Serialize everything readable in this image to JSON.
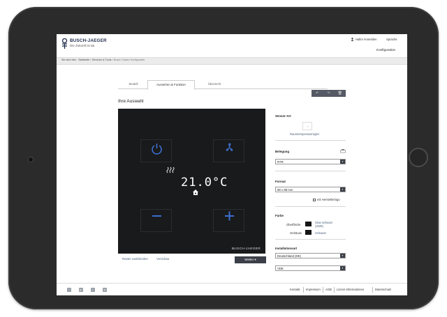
{
  "header": {
    "brand": "BUSCH-JAEGER",
    "tagline": "Die Zukunft ist da.",
    "login": "Hallo! Anmelden",
    "language": "Sprache",
    "page": "Konfiguration"
  },
  "breadcrumb": {
    "prefix": "Sie sind hier:",
    "items": [
      "Startseite",
      "Services & Tools",
      "Busch-Tastex Konfigurator"
    ]
  },
  "tabs": [
    "Modell",
    "Aussehen & Funktion",
    "Übersicht"
  ],
  "toolbar": {
    "undo_icon": "↶",
    "redo_icon": "↷",
    "delete_icon": "🗑"
  },
  "main": {
    "heading": "Ihre Auswahl",
    "display_temp": "21.0°C",
    "preview_brand": "BUSCH-JAEGER",
    "links": [
      "Raster ausblenden",
      "Vorschau"
    ],
    "next_button": "Weiter"
  },
  "right_panel": {
    "sensor_label": "Sensor-Art",
    "sensor_value": "Raumtemperaturregler",
    "belegung_label": "Belegung",
    "belegung_value": "RTR",
    "format_label": "Format",
    "format_value": "88 x 88 mm",
    "logo_checkbox": "mit Herstellerlogo",
    "farbe_label": "Farbe",
    "surface_label": "Oberfläche",
    "surface_value": "Glas schwarz (J625)",
    "housing_label": "Gehäuse",
    "housing_value": "Schwarz",
    "install_label": "Installationsart",
    "install_value": "Deutschland (DE)",
    "norm_value": "VDE"
  },
  "footer": {
    "social": [
      "f",
      "g+",
      "t",
      "yt"
    ],
    "links": [
      "Kontakt",
      "Impressum",
      "AGB",
      "Lizenz-Informationen",
      "Datenschutz"
    ]
  },
  "colors": {
    "brand": "#1f2b4d",
    "accent_icon": "#3c6fd0",
    "device": "#191a1c"
  }
}
